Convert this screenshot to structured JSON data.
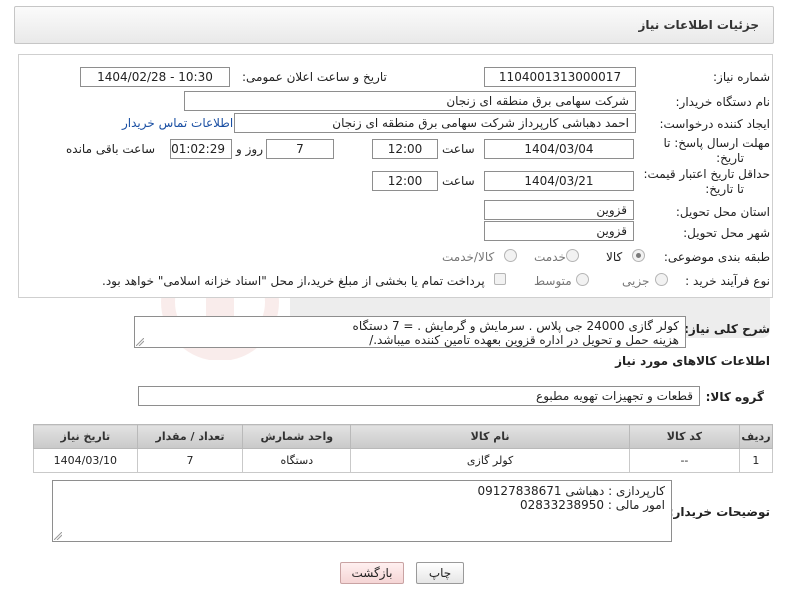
{
  "header": {
    "title": "جزئیات اطلاعات نیاز"
  },
  "form": {
    "need_number_label": "شماره نیاز:",
    "need_number": "1104001313000017",
    "announce_label": "تاریخ و ساعت اعلان عمومی:",
    "announce_value": "1404/02/28 - 10:30",
    "buyer_org_label": "نام دستگاه خریدار:",
    "buyer_org": "شرکت سهامی برق منطقه ای زنجان",
    "creator_label": "ایجاد کننده درخواست:",
    "creator": "احمد دهباشی کارپرداز شرکت سهامی برق منطقه ای زنجان",
    "contact_link": "اطلاعات تماس خریدار",
    "deadline_label_1": "مهلت ارسال پاسخ: تا",
    "deadline_label_2": "تاریخ:",
    "deadline_date": "1404/03/04",
    "time_label": "ساعت",
    "deadline_time": "12:00",
    "days_value": "7",
    "days_label": "روز و",
    "remaining_time": "01:02:29",
    "remaining_label": "ساعت باقی مانده",
    "price_validity_label_1": "حداقل تاریخ اعتبار قیمت:",
    "price_validity_label_2": "تا تاریخ:",
    "price_validity_date": "1404/03/21",
    "price_validity_time": "12:00",
    "province_label": "استان محل تحویل:",
    "province": "قزوین",
    "city_label": "شهر محل تحویل:",
    "city": "قزوین",
    "category_label": "طبقه بندی موضوعی:",
    "category_options": [
      "کالا",
      "خدمت",
      "کالا/خدمت"
    ],
    "process_label": "نوع فرآیند خرید :",
    "process_options": [
      "جزیی",
      "متوسط"
    ],
    "payment_note": "پرداخت تمام یا بخشی از مبلغ خرید،از محل \"اسناد خزانه اسلامی\" خواهد بود."
  },
  "description": {
    "label": "شرح کلی نیاز:",
    "line1": "کولر گازی 24000 جی پلاس . سرمایش و گرمایش .  =  7 دستگاه",
    "line2": "هزینه حمل و تحویل در اداره قزوین بعهده تامین کننده میباشد./"
  },
  "goods_section": {
    "title": "اطلاعات کالاهای مورد نیاز",
    "group_label": "گروه کالا:",
    "group_value": "قطعات و تجهیزات تهویه مطبوع"
  },
  "table": {
    "headers": [
      "ردیف",
      "کد کالا",
      "نام کالا",
      "واحد شمارش",
      "تعداد / مقدار",
      "تاریخ نیاز"
    ],
    "rows": [
      [
        "1",
        "--",
        "کولر گازی",
        "دستگاه",
        "7",
        "1404/03/10"
      ]
    ]
  },
  "buyer_notes": {
    "label": "توضیحات خریدار:",
    "line1": "کارپردازی : دهباشی  09127838671",
    "line2": "امور مالی : 02833238950"
  },
  "buttons": {
    "print": "چاپ",
    "back": "بازگشت"
  },
  "colors": {
    "link": "#1a4fa3",
    "back_button": "#f5d5d5"
  }
}
